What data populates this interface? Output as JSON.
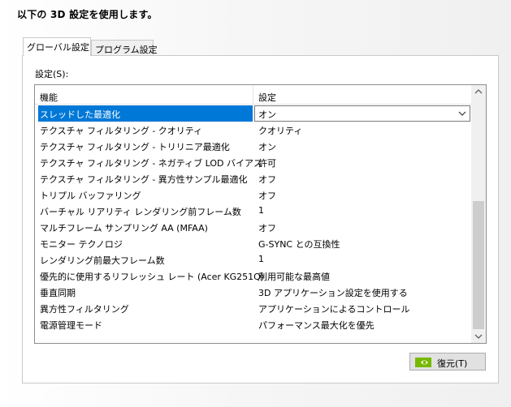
{
  "heading": "以下の 3D 設定を使用します。",
  "tabs": [
    {
      "label": "グローバル設定"
    },
    {
      "label": "プログラム設定"
    }
  ],
  "settings_label": "設定(S):",
  "grid": {
    "columns": {
      "feature": "機能",
      "setting": "設定"
    },
    "rows": [
      {
        "feature": "スレッドした最適化",
        "value": "オン"
      },
      {
        "feature": "テクスチャ フィルタリング - クオリティ",
        "value": "クオリティ"
      },
      {
        "feature": "テクスチャ フィルタリング - トリリニア最適化",
        "value": "オン"
      },
      {
        "feature": "テクスチャ フィルタリング - ネガティブ LOD バイアス",
        "value": "許可"
      },
      {
        "feature": "テクスチャ フィルタリング - 異方性サンプル最適化",
        "value": "オフ"
      },
      {
        "feature": "トリプル バッファリング",
        "value": "オフ"
      },
      {
        "feature": "バーチャル リアリティ レンダリング前フレーム数",
        "value": "1"
      },
      {
        "feature": "マルチフレーム サンプリング AA (MFAA)",
        "value": "オフ"
      },
      {
        "feature": "モニター テクノロジ",
        "value": "G-SYNC との互換性"
      },
      {
        "feature": "レンダリング前最大フレーム数",
        "value": "1"
      },
      {
        "feature": "優先的に使用するリフレッシュ レート (Acer KG251Q)",
        "value": "利用可能な最高値"
      },
      {
        "feature": "垂直同期",
        "value": "3D アプリケーション設定を使用する"
      },
      {
        "feature": "異方性フィルタリング",
        "value": "アプリケーションによるコントロール"
      },
      {
        "feature": "電源管理モード",
        "value": "パフォーマンス最大化を優先"
      }
    ]
  },
  "restore_button": {
    "label": "復元(T)"
  },
  "colors": {
    "selection": "#0078d7",
    "nvidia_green": "#76b900"
  }
}
